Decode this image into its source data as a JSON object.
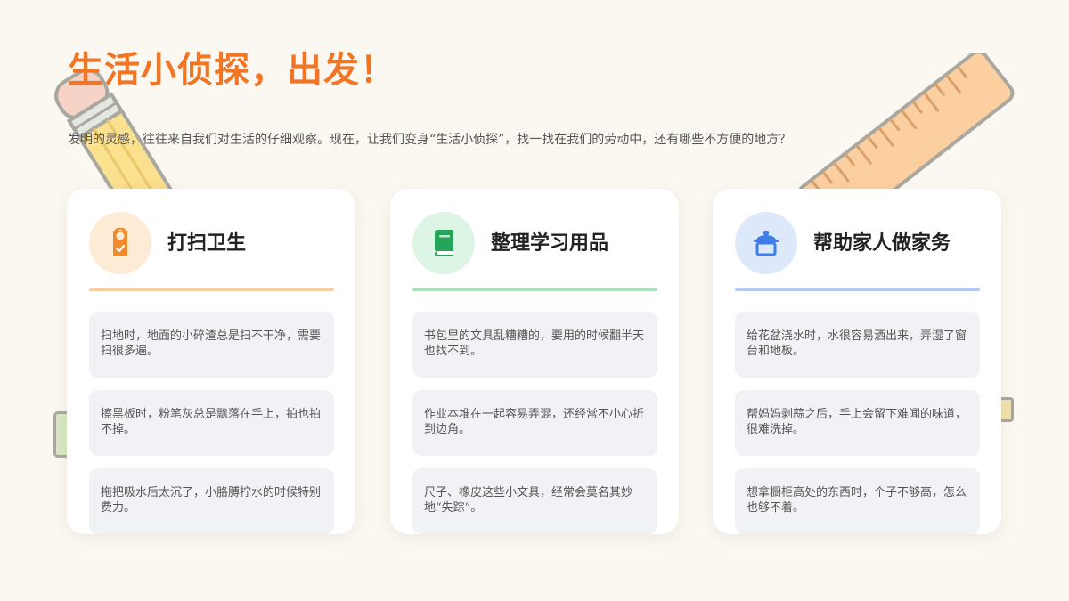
{
  "header": {
    "title": "生活小侦探，出发！",
    "subtitle": "发明的灵感，往往来自我们对生活的仔细观察。现在，让我们变身“生活小侦探”，找一找在我们的劳动中，还有哪些不方便的地方？"
  },
  "colors": {
    "title": "#f07525",
    "background": "#fbf8f2",
    "card1_accent": "#f39a3c",
    "card2_accent": "#25a55a",
    "card3_accent": "#3d7ee8"
  },
  "cards": [
    {
      "title": "打扫卫生",
      "icon": "door-hanger-icon",
      "items": [
        "扫地时，地面的小碎渣总是扫不干净，需要扫很多遍。",
        "擦黑板时，粉笔灰总是飘落在手上，拍也拍不掉。",
        "拖把吸水后太沉了，小胳膊拧水的时候特别费力。"
      ]
    },
    {
      "title": "整理学习用品",
      "icon": "book-icon",
      "items": [
        "书包里的文具乱糟糟的，要用的时候翻半天也找不到。",
        "作业本堆在一起容易弄混，还经常不小心折到边角。",
        "尺子、橡皮这些小文具，经常会莫名其妙地“失踪”。"
      ]
    },
    {
      "title": "帮助家人做家务",
      "icon": "cooking-pot-icon",
      "items": [
        "给花盆浇水时，水很容易洒出来，弄湿了窗台和地板。",
        "帮妈妈剥蒜之后，手上会留下难闻的味道，很难洗掉。",
        "想拿橱柜高处的东西时，个子不够高，怎么也够不着。"
      ]
    }
  ]
}
